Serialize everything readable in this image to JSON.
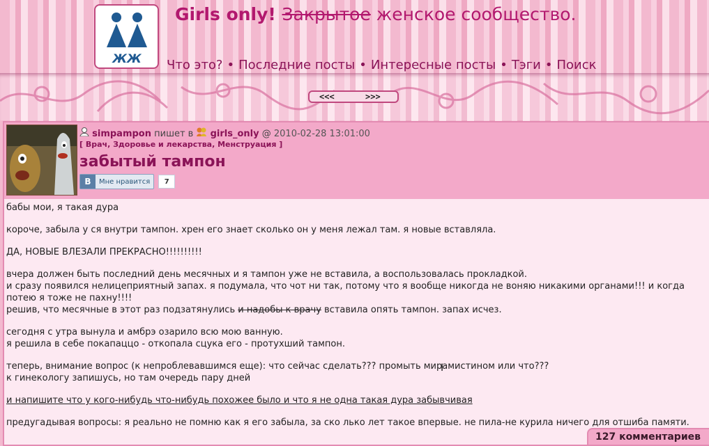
{
  "header": {
    "logo_text": "ЖЖ",
    "title_main": "Girls only! ",
    "title_strike": "Закрытое",
    "title_rest": " женское сообщество.",
    "nav": [
      "Что это?",
      "Последние посты",
      "Интересные посты",
      "Тэги",
      "Поиск"
    ],
    "nav_separator": "•"
  },
  "pager": {
    "prev": "<<<",
    "next": ">>>"
  },
  "post": {
    "author": "simpampon",
    "writes_in": " пишет в ",
    "community": "girls_only",
    "at": " @ ",
    "date": "2010-02-28 13:01:00",
    "tags_open": "[ ",
    "tags": "Врач, Здоровье и лекарства, Менструация",
    "tags_close": " ]",
    "title": "забытый тампон",
    "like": {
      "logo": "В",
      "label": "Мне нравится",
      "count": "7"
    },
    "paragraphs": {
      "p1": "бабы мои, я такая дура",
      "p2": "короче, забыла у ся внутри тампон. хрен его знает сколько он у меня лежал там. я новые вставляла.",
      "p3": "ДА, НОВЫЕ ВЛЕЗАЛИ ПРЕКРАСНО!!!!!!!!!!",
      "p4a": "вчера должен быть последний день месячных и я тампон уже не вставила, а воспользовалась прокладкой.",
      "p4b": "и сразу появился нелицеприятный запах. я подумала, что чот ни так, потому что я вообще никогда не воняю никакими органами!!! и когда потею я тоже не пахну!!!!",
      "p4c_pre": "решив, что месячные в этот раз подзатянулись ",
      "p4c_strike": "и надобы к врачу",
      "p4c_post": " вставила опять тампон. запах исчез.",
      "p5a": "сегодня с утра вынула и амбрэ озарило всю мою ванную.",
      "p5b": "я решила в себе покапаццо - откопала сцука его - протухший тампон.",
      "p6a": "теперь, внимание вопрос (к непроблевавшимся еще): что сейчас сделать??? промыть мирамистином или что???",
      "p6b": "к гинекологу запишусь, но там очередь пару дней",
      "p7": "и напишите что у кого-нибудь что-нибудь похожее было и что я не одна такая дура забывчивая",
      "p8": "предугадывая вопросы: я реально не помню как я его забыла, за ско лько лет такое впервые. не пила-не курила ничего для отшиба памяти."
    },
    "comments": "127 комментариев"
  },
  "colors": {
    "accent": "#b2186e",
    "link": "#8a1357",
    "post_bg": "#fde9f2",
    "post_head": "#f3a9c9"
  }
}
